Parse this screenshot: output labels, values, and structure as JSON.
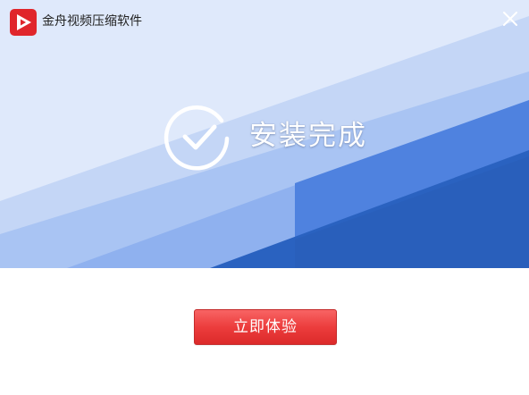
{
  "window": {
    "title": "金舟视频压缩软件",
    "logo_icon": "play-logo-icon",
    "close_icon": "close-icon"
  },
  "status": {
    "icon": "check-circle-icon",
    "text": "安装完成"
  },
  "actions": {
    "primary_label": "立即体验"
  },
  "colors": {
    "logo_red": "#e0262b",
    "button_red": "#ec3d3d",
    "banner_dark_blue": "#2a62c0",
    "banner_light_blue": "#dfe9fb"
  }
}
